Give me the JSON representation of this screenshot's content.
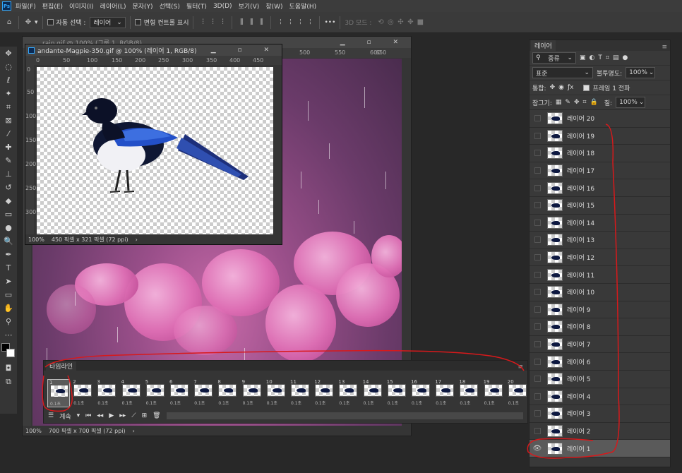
{
  "menubar": {
    "logo": "Ps",
    "items": [
      "파일(F)",
      "편집(E)",
      "이미지(I)",
      "레이어(L)",
      "문자(Y)",
      "선택(S)",
      "필터(T)",
      "3D(D)",
      "보기(V)",
      "창(W)",
      "도움말(H)"
    ]
  },
  "optionsbar": {
    "auto_select_label": "자동 선택 :",
    "auto_select_value": "레이어",
    "transform_controls_label": "변형 컨트롤 표시",
    "mode_3d_label": "3D 모드 :",
    "more_label": "•••"
  },
  "doc_back": {
    "title": "rain.gif @ 100% (그룹 1, RGB/8)",
    "ruler_ticks": [
      "500",
      "550",
      "600",
      "650"
    ],
    "status_zoom": "100%",
    "status_info": "700 픽셀 x 700 픽셀 (72 ppi)"
  },
  "doc_front": {
    "title": "andante-Magpie-350.gif @ 100% (레이어 1, RGB/8)",
    "ruler_ticks": [
      "0",
      "50",
      "100",
      "150",
      "200",
      "250",
      "300",
      "350",
      "400",
      "450"
    ],
    "vruler_ticks": [
      "0",
      "50",
      "100",
      "150",
      "200",
      "250",
      "300"
    ],
    "status_zoom": "100%",
    "status_info": "450 픽셀 x 321 픽셀 (72 ppi)"
  },
  "layers_panel": {
    "tab": "레이어",
    "filter_kind": "종류",
    "blend_mode": "표준",
    "opacity_label": "불투명도:",
    "opacity_value": "100%",
    "unify_label": "통합:",
    "propagate_label": "프레임 1 전파",
    "lock_label": "잠그기:",
    "fill_label": "칠:",
    "fill_value": "100%",
    "layers": [
      "레이어 20",
      "레이어 19",
      "레이어 18",
      "레이어 17",
      "레이어 16",
      "레이어 15",
      "레이어 14",
      "레이어 13",
      "레이어 12",
      "레이어 11",
      "레이어 10",
      "레이어 9",
      "레이어 8",
      "레이어 7",
      "레이어 6",
      "레이어 5",
      "레이어 4",
      "레이어 3",
      "레이어 2",
      "레이어 1"
    ],
    "visible_layer": "레이어 1"
  },
  "timeline": {
    "tab": "타임라인",
    "frames": [
      "1",
      "2",
      "3",
      "4",
      "5",
      "6",
      "7",
      "8",
      "9",
      "10",
      "11",
      "12",
      "13",
      "14",
      "15",
      "16",
      "17",
      "18",
      "19",
      "20"
    ],
    "delay": "0.1초",
    "selected_frame": "1",
    "loop_label": "계속"
  },
  "colors": {
    "accent_red": "#d8191b",
    "ps_blue": "#31a8ff",
    "panel_bg": "#393939"
  }
}
